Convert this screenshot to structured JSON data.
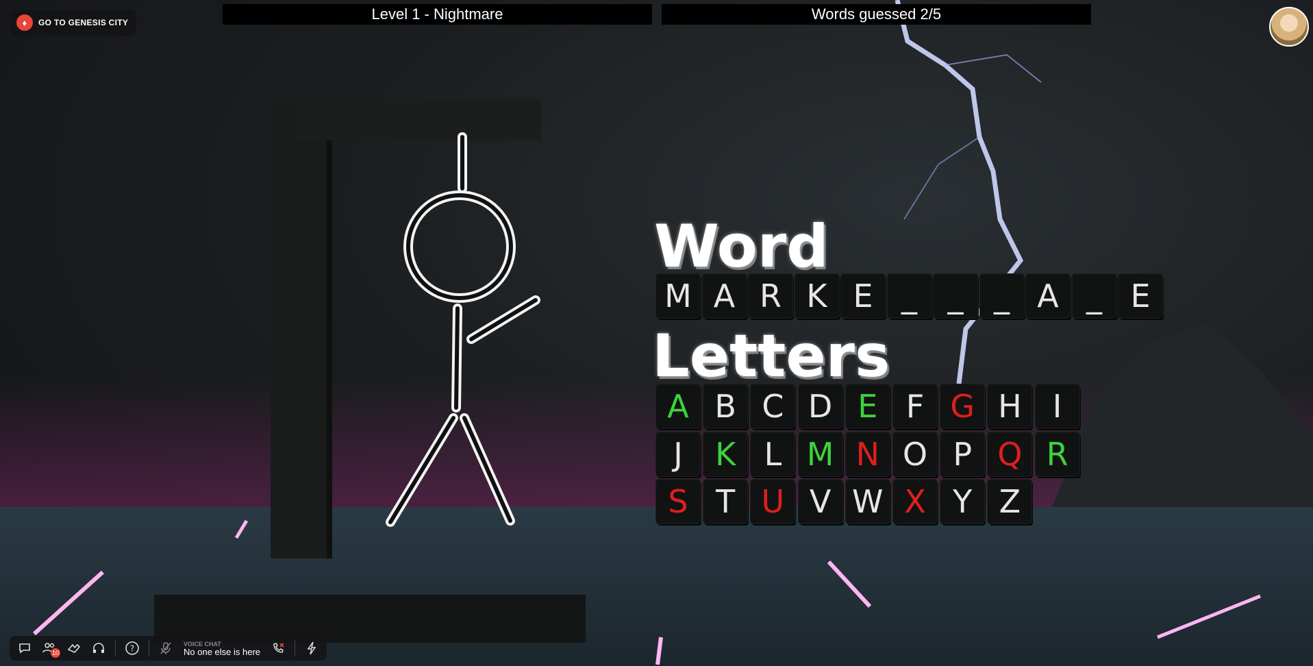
{
  "hud": {
    "level": "Level 1 - Nightmare",
    "words_guessed": "Words guessed 2/5",
    "go_to_city": "GO TO GENESIS CITY"
  },
  "word": {
    "heading": "Word",
    "slots": [
      "M",
      "A",
      "R",
      "K",
      "E",
      "_",
      "_",
      "_",
      "A",
      "_",
      "E"
    ]
  },
  "letters": {
    "heading": "Letters",
    "rows": [
      [
        {
          "l": "A",
          "s": "correct"
        },
        {
          "l": "B",
          "s": "unused"
        },
        {
          "l": "C",
          "s": "unused"
        },
        {
          "l": "D",
          "s": "unused"
        },
        {
          "l": "E",
          "s": "correct"
        },
        {
          "l": "F",
          "s": "unused"
        },
        {
          "l": "G",
          "s": "wrong"
        },
        {
          "l": "H",
          "s": "unused"
        },
        {
          "l": "I",
          "s": "unused"
        }
      ],
      [
        {
          "l": "J",
          "s": "unused"
        },
        {
          "l": "K",
          "s": "correct"
        },
        {
          "l": "L",
          "s": "unused"
        },
        {
          "l": "M",
          "s": "correct"
        },
        {
          "l": "N",
          "s": "wrong"
        },
        {
          "l": "O",
          "s": "unused"
        },
        {
          "l": "P",
          "s": "unused"
        },
        {
          "l": "Q",
          "s": "wrong"
        },
        {
          "l": "R",
          "s": "correct"
        }
      ],
      [
        {
          "l": "S",
          "s": "wrong"
        },
        {
          "l": "T",
          "s": "unused"
        },
        {
          "l": "U",
          "s": "wrong"
        },
        {
          "l": "V",
          "s": "unused"
        },
        {
          "l": "W",
          "s": "unused"
        },
        {
          "l": "X",
          "s": "wrong"
        },
        {
          "l": "Y",
          "s": "unused"
        },
        {
          "l": "Z",
          "s": "unused"
        }
      ]
    ]
  },
  "bottom_bar": {
    "friends_badge": "10",
    "voice_label": "VOICE CHAT",
    "voice_status": "No one else is here"
  },
  "colors": {
    "correct": "#3dd23d",
    "wrong": "#e01e1e",
    "neutral": "#e6e6e6"
  },
  "icons": [
    "chat-icon",
    "friends-icon",
    "emote-icon",
    "headphones-icon",
    "help-icon",
    "mic-off-icon",
    "call-end-icon",
    "lightning-icon",
    "genesis-city-icon"
  ]
}
